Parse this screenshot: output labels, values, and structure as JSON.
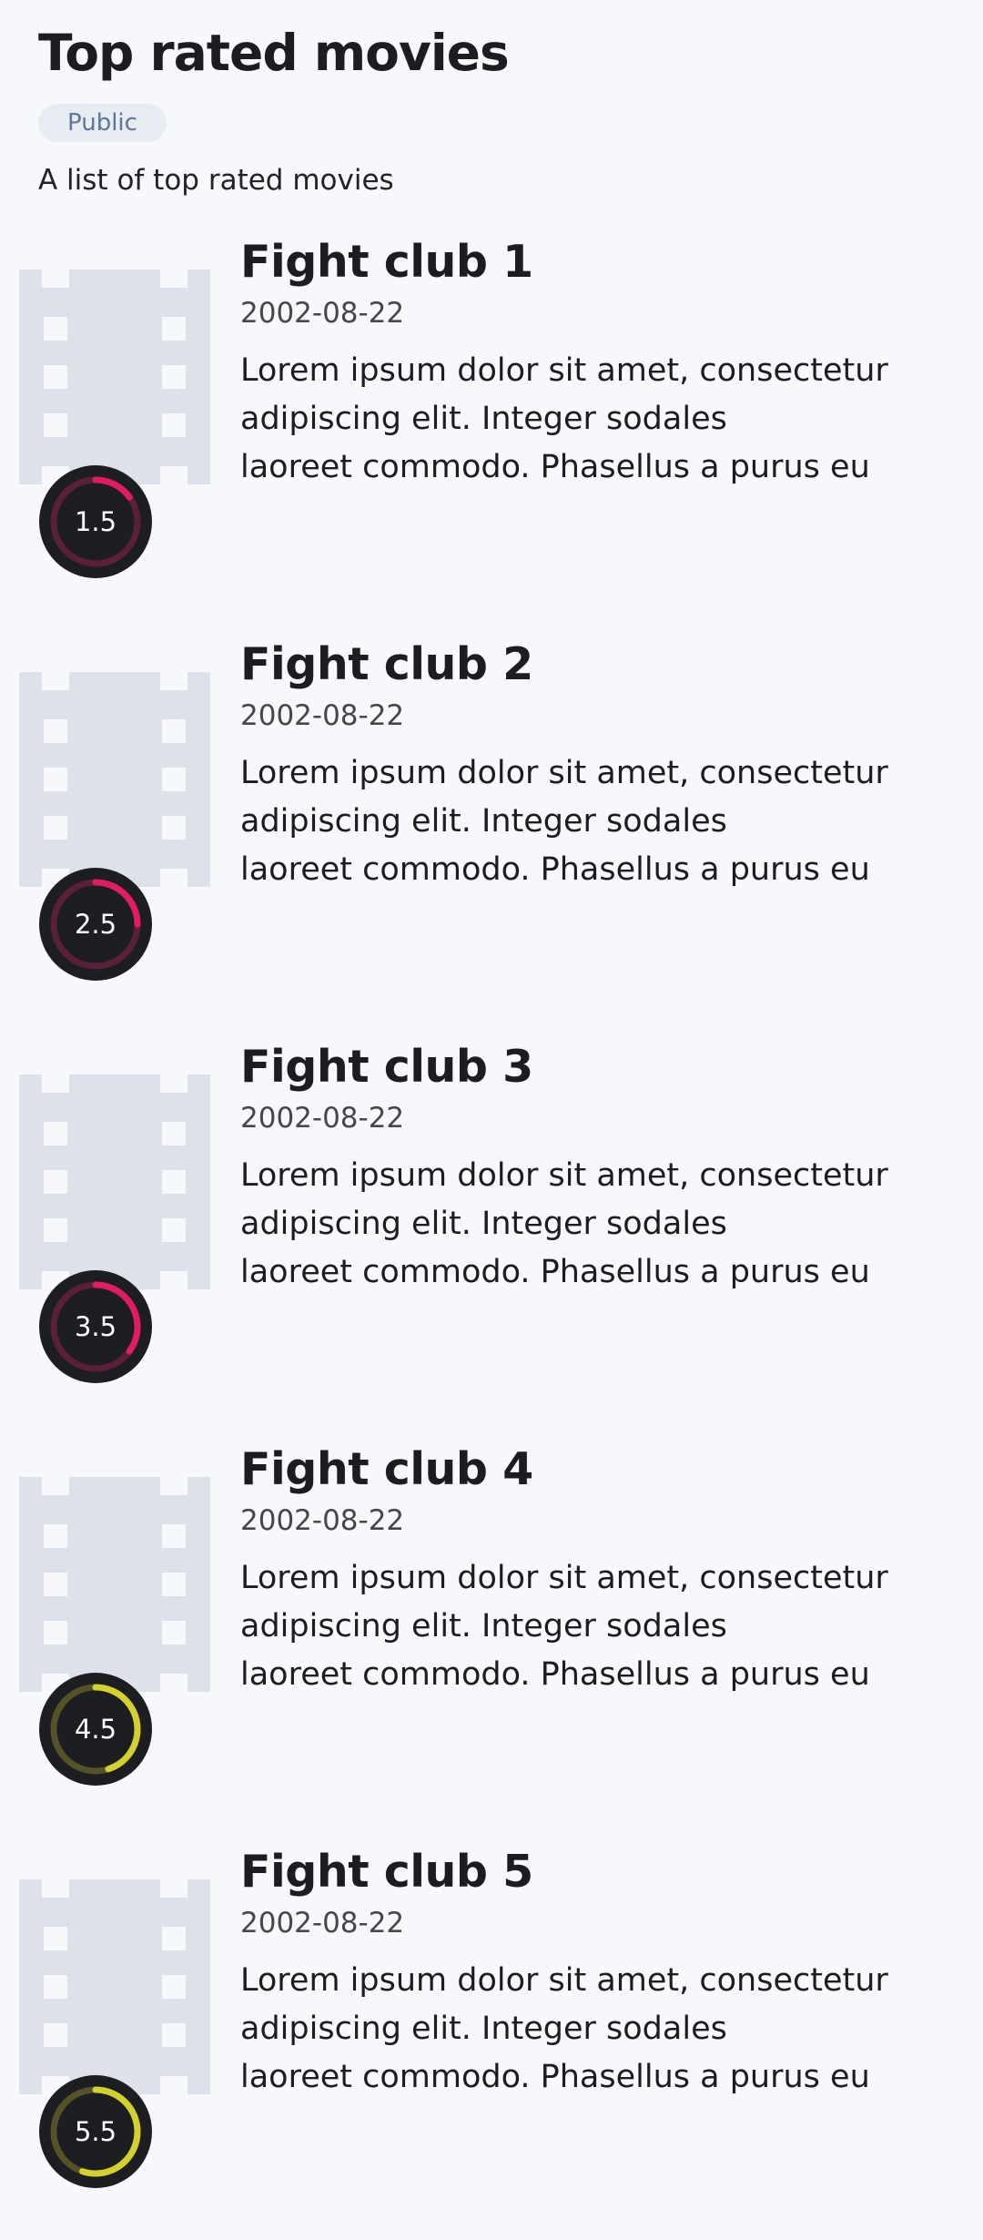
{
  "header": {
    "title": "Top rated movies",
    "badge": "Public",
    "description": "A list of top rated movies"
  },
  "colors": {
    "background": "#f7f8fc",
    "poster_placeholder": "#dde1e9",
    "rating_bg": "#1c1e22",
    "rating_low_track": "#5a1f3a",
    "rating_low_arc": "#e01d62",
    "rating_mid_track": "#545226",
    "rating_mid_arc": "#d4d12f"
  },
  "movies": [
    {
      "title": "Fight club 1",
      "date": "2002-08-22",
      "overview_lines": [
        "Lorem ipsum dolor sit amet, consectetur",
        "adipiscing elit. Integer sodales",
        "laoreet commodo. Phasellus a purus eu"
      ],
      "rating_label": "1.5",
      "rating_progress": 0.15,
      "poster_icon": "film-strip-icon"
    },
    {
      "title": "Fight club 2",
      "date": "2002-08-22",
      "overview_lines": [
        "Lorem ipsum dolor sit amet, consectetur",
        "adipiscing elit. Integer sodales",
        "laoreet commodo. Phasellus a purus eu"
      ],
      "rating_label": "2.5",
      "rating_progress": 0.25,
      "poster_icon": "film-strip-icon"
    },
    {
      "title": "Fight club 3",
      "date": "2002-08-22",
      "overview_lines": [
        "Lorem ipsum dolor sit amet, consectetur",
        "adipiscing elit. Integer sodales",
        "laoreet commodo. Phasellus a purus eu"
      ],
      "rating_label": "3.5",
      "rating_progress": 0.35,
      "poster_icon": "film-strip-icon"
    },
    {
      "title": "Fight club 4",
      "date": "2002-08-22",
      "overview_lines": [
        "Lorem ipsum dolor sit amet, consectetur",
        "adipiscing elit. Integer sodales",
        "laoreet commodo. Phasellus a purus eu"
      ],
      "rating_label": "4.5",
      "rating_progress": 0.45,
      "poster_icon": "film-strip-icon"
    },
    {
      "title": "Fight club 5",
      "date": "2002-08-22",
      "overview_lines": [
        "Lorem ipsum dolor sit amet, consectetur",
        "adipiscing elit. Integer sodales",
        "laoreet commodo. Phasellus a purus eu"
      ],
      "rating_label": "5.5",
      "rating_progress": 0.55,
      "poster_icon": "film-strip-icon"
    }
  ]
}
